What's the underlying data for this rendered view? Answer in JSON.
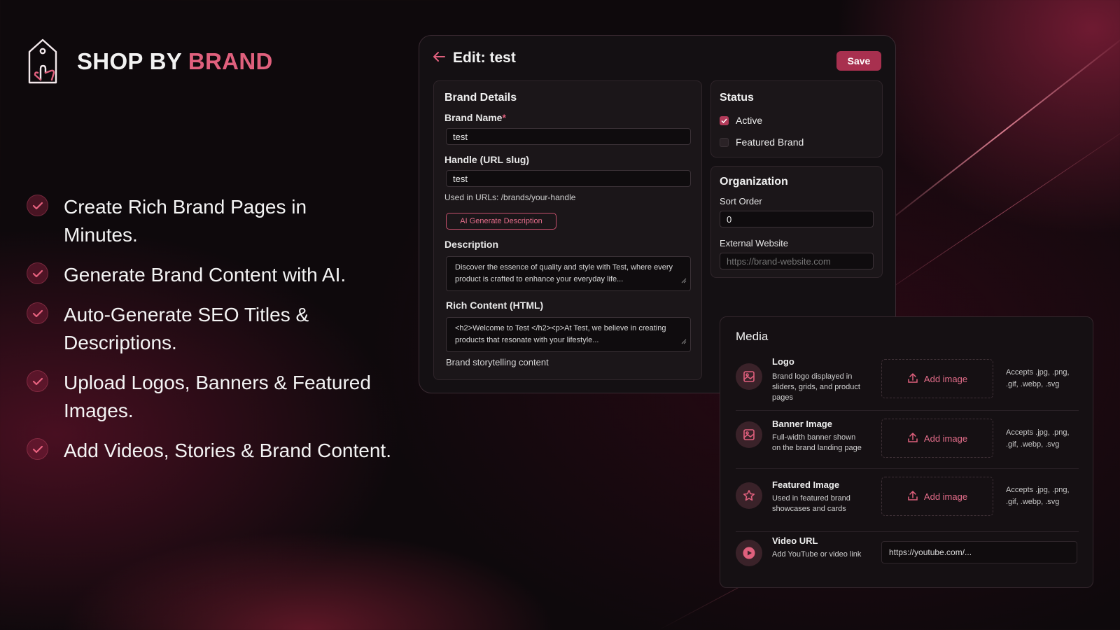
{
  "brand": {
    "name_part1": "SHOP BY",
    "name_part2": "BRAND",
    "accent_color": "#e0607d",
    "logo_icon": "tag-hand-icon"
  },
  "features": [
    {
      "text": "Create Rich Brand Pages in Minutes."
    },
    {
      "text": "Generate Brand Content with AI."
    },
    {
      "text": "Auto-Generate SEO Titles & Descriptions."
    },
    {
      "text": "Upload Logos, Banners & Featured Images."
    },
    {
      "text": "Add Videos, Stories & Brand Content."
    }
  ],
  "editor": {
    "back_icon": "arrow-left-icon",
    "title": "Edit: test",
    "save_label": "Save",
    "save_color": "#a8304f"
  },
  "brand_details": {
    "title": "Brand Details",
    "brand_name_label": "Brand Name",
    "required_mark": "*",
    "brand_name_value": "test",
    "handle_label": "Handle (URL slug)",
    "handle_value": "test",
    "handle_hint": "Used in URLs: /brands/your-handle",
    "ai_button": "AI Generate Description",
    "description_label": "Description",
    "description_value": "Discover the essence of quality and style with Test, where every product is crafted to enhance your everyday life...",
    "rich_label": "Rich Content (HTML)",
    "rich_value": "<h2>Welcome to Test </h2><p>At Test, we believe in creating products that resonate with your lifestyle...",
    "rich_hint": "Brand storytelling content"
  },
  "status": {
    "title": "Status",
    "active_label": "Active",
    "active_checked": true,
    "featured_label": "Featured Brand",
    "featured_checked": false
  },
  "organization": {
    "title": "Organization",
    "sort_label": "Sort Order",
    "sort_value": "0",
    "website_label": "External Website",
    "website_placeholder": "https://brand-website.com"
  },
  "media": {
    "title": "Media",
    "items": [
      {
        "name": "Logo",
        "desc": "Brand logo displayed in sliders, grids, and product pages",
        "add": "Add image",
        "accepts": "Accepts .jpg, .png, .gif, .webp, .svg",
        "icon": "image-icon"
      },
      {
        "name": "Banner Image",
        "desc": "Full-width banner shown on the brand landing page",
        "add": "Add image",
        "accepts": "Accepts .jpg, .png, .gif, .webp, .svg",
        "icon": "image-icon"
      },
      {
        "name": "Featured Image",
        "desc": "Used in featured brand showcases and cards",
        "add": "Add image",
        "accepts": "Accepts .jpg, .png, .gif, .webp, .svg",
        "icon": "star-icon"
      }
    ],
    "video": {
      "name": "Video URL",
      "desc": "Add YouTube or video link",
      "placeholder": "https://youtube.com/...",
      "icon": "play-icon"
    }
  }
}
